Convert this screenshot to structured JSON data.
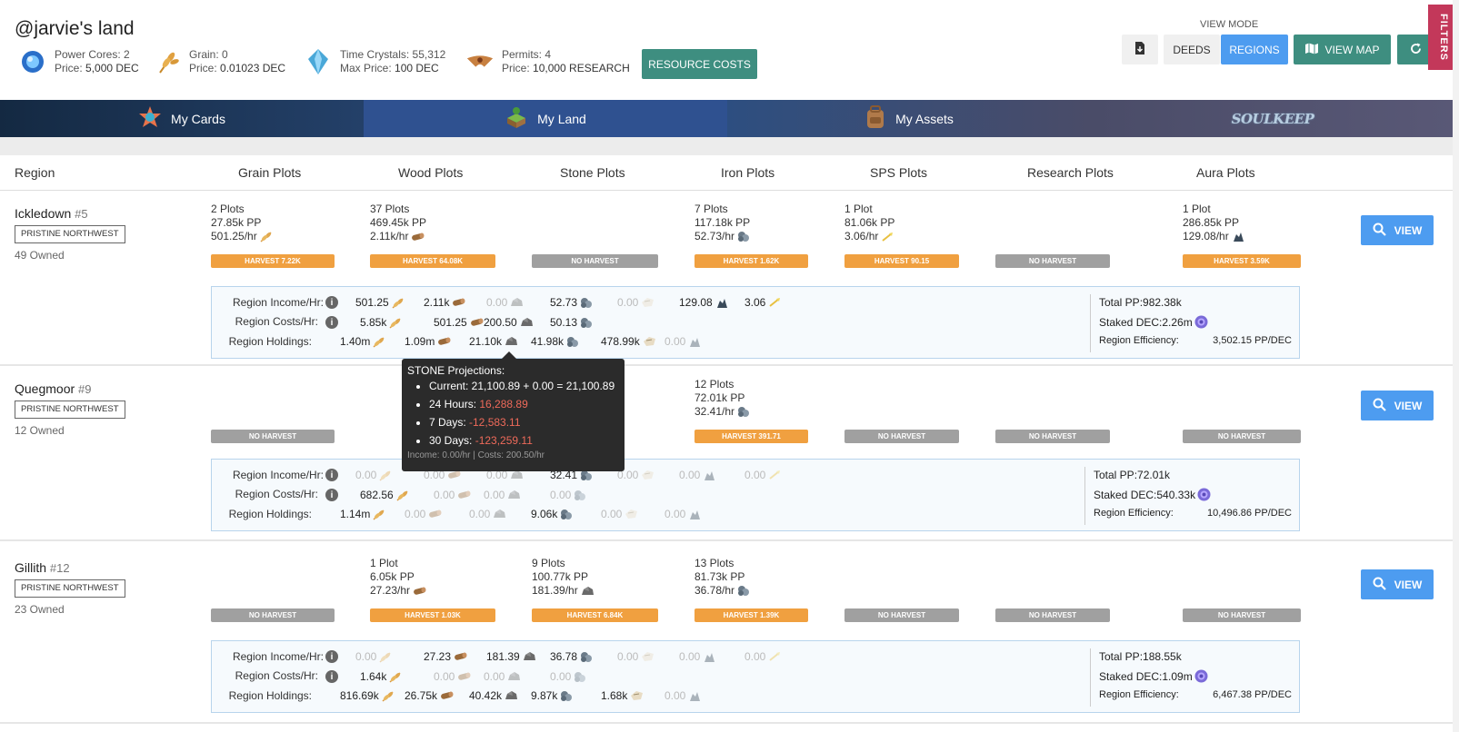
{
  "header": {
    "title": "@jarvie's land",
    "resources": [
      {
        "name": "power-cores",
        "line1": "Power Cores: 2",
        "line2_prefix": "Price: ",
        "line2_value": "5,000 DEC",
        "icon": "power-core-icon"
      },
      {
        "name": "grain",
        "line1": "Grain: 0",
        "line2_prefix": "Price: ",
        "line2_value": "0.01023 DEC",
        "icon": "grain-icon"
      },
      {
        "name": "time-crystals",
        "line1": "Time Crystals: 55,312",
        "line2_prefix": "Max Price: ",
        "line2_value": "100 DEC",
        "icon": "time-crystal-icon"
      },
      {
        "name": "permits",
        "line1": "Permits: 4",
        "line2_prefix": "Price: ",
        "line2_value": "10,000 RESEARCH",
        "icon": "permit-icon"
      }
    ],
    "resource_costs_label": "RESOURCE COSTS",
    "view_mode_label": "VIEW MODE",
    "deeds_label": "DEEDS",
    "regions_label": "REGIONS",
    "view_map_label": "VIEW MAP",
    "filters_label": "FILTERS"
  },
  "nav": {
    "tabs": [
      {
        "label": "My Cards"
      },
      {
        "label": "My Land"
      },
      {
        "label": "My Assets"
      },
      {
        "label": "SOULKEEP"
      }
    ],
    "active": 1
  },
  "columns": [
    "Region",
    "Grain Plots",
    "Wood Plots",
    "Stone Plots",
    "Iron Plots",
    "SPS Plots",
    "Research Plots",
    "Aura Plots"
  ],
  "regions": [
    {
      "name": "Ickledown",
      "num": "#5",
      "tag": "PRISTINE NORTHWEST",
      "owned": "49 Owned",
      "plots": {
        "grain": [
          "2 Plots",
          "27.85k PP",
          "501.25/hr"
        ],
        "wood": [
          "37 Plots",
          "469.45k PP",
          "2.11k/hr"
        ],
        "iron": [
          "7 Plots",
          "117.18k PP",
          "52.73/hr"
        ],
        "sps": [
          "1 Plot",
          "81.06k PP",
          "3.06/hr"
        ],
        "aura": [
          "1 Plot",
          "286.85k PP",
          "129.08/hr"
        ]
      },
      "harvest": [
        "HARVEST 7.22K",
        "HARVEST 64.08K",
        "NO HARVEST",
        "HARVEST 1.62K",
        "HARVEST 90.15",
        "NO HARVEST",
        "HARVEST 3.59K"
      ],
      "income": [
        "501.25",
        "2.11k",
        "0.00",
        "52.73",
        "0.00",
        "129.08",
        "3.06"
      ],
      "costs": [
        "5.85k",
        "501.25",
        "200.50",
        "50.13"
      ],
      "holdings": [
        "1.40m",
        "1.09m",
        "21.10k",
        "41.98k",
        "478.99k",
        "0.00"
      ],
      "total_pp": "Total PP:982.38k",
      "staked": "Staked DEC:2.26m",
      "eff_label": "Region Efficiency:",
      "eff": "3,502.15 PP/DEC"
    },
    {
      "name": "Quegmoor",
      "num": "#9",
      "tag": "PRISTINE NORTHWEST",
      "owned": "12 Owned",
      "plots": {
        "iron": [
          "12 Plots",
          "72.01k PP",
          "32.41/hr"
        ]
      },
      "harvest": [
        "NO HARVEST",
        "",
        "",
        "HARVEST 391.71",
        "NO HARVEST",
        "NO HARVEST",
        "NO HARVEST"
      ],
      "income": [
        "0.00",
        "0.00",
        "0.00",
        "32.41",
        "0.00",
        "0.00",
        "0.00"
      ],
      "costs": [
        "682.56",
        "0.00",
        "0.00",
        "0.00"
      ],
      "holdings": [
        "1.14m",
        "0.00",
        "0.00",
        "9.06k",
        "0.00",
        "0.00"
      ],
      "total_pp": "Total PP:72.01k",
      "staked": "Staked DEC:540.33k",
      "eff_label": "Region Efficiency:",
      "eff": "10,496.86 PP/DEC"
    },
    {
      "name": "Gillith",
      "num": "#12",
      "tag": "PRISTINE NORTHWEST",
      "owned": "23 Owned",
      "plots": {
        "wood": [
          "1 Plot",
          "6.05k PP",
          "27.23/hr"
        ],
        "stone": [
          "9 Plots",
          "100.77k PP",
          "181.39/hr"
        ],
        "iron": [
          "13 Plots",
          "81.73k PP",
          "36.78/hr"
        ]
      },
      "harvest": [
        "NO HARVEST",
        "HARVEST 1.03K",
        "HARVEST 6.84K",
        "HARVEST 1.39K",
        "NO HARVEST",
        "NO HARVEST",
        "NO HARVEST"
      ],
      "income": [
        "0.00",
        "27.23",
        "181.39",
        "36.78",
        "0.00",
        "0.00",
        "0.00"
      ],
      "costs": [
        "1.64k",
        "0.00",
        "0.00",
        "0.00"
      ],
      "holdings": [
        "816.69k",
        "26.75k",
        "40.42k",
        "9.87k",
        "1.68k",
        "0.00"
      ],
      "total_pp": "Total PP:188.55k",
      "staked": "Staked DEC:1.09m",
      "eff_label": "Region Efficiency:",
      "eff": "6,467.38 PP/DEC"
    }
  ],
  "labels": {
    "income": "Region Income/Hr:",
    "costs": "Region Costs/Hr:",
    "holdings": "Region Holdings:",
    "view": "VIEW"
  },
  "tooltip": {
    "title": "STONE Projections:",
    "current": "Current: 21,100.89 + 0.00 = 21,100.89",
    "h24_label": "24 Hours: ",
    "h24": "16,288.89",
    "d7_label": "7 Days: ",
    "d7": "-12,583.11",
    "d30_label": "30 Days: ",
    "d30": "-123,259.11",
    "foot": "Income: 0.00/hr | Costs: 200.50/hr"
  },
  "colors": {
    "accent": "#4d9cf0",
    "teal": "#3e8e80",
    "harvest": "#f0a040",
    "noharvest": "#a0a0a0",
    "filters": "#c3385a"
  }
}
